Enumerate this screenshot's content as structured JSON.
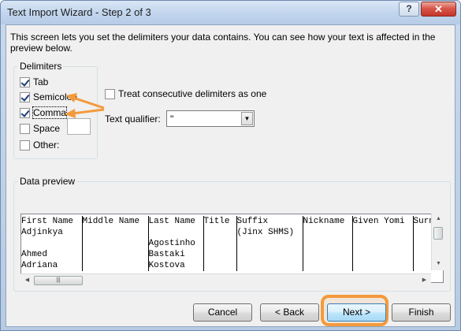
{
  "window": {
    "title": "Text Import Wizard - Step 2 of 3",
    "help_label": "?",
    "close_label": "✕"
  },
  "intro": "This screen lets you set the delimiters your data contains.  You can see how your text is affected in the preview below.",
  "delimiters": {
    "legend": "Delimiters",
    "items": [
      {
        "label": "Tab",
        "checked": true
      },
      {
        "label": "Semicolon",
        "checked": true
      },
      {
        "label": "Comma",
        "checked": true
      },
      {
        "label": "Space",
        "checked": false
      },
      {
        "label": "Other:",
        "checked": false
      }
    ],
    "other_value": ""
  },
  "options": {
    "treat_consecutive_label": "Treat consecutive delimiters as one",
    "treat_consecutive_checked": false,
    "text_qualifier_label": "Text qualifier:",
    "text_qualifier_value": "\""
  },
  "preview": {
    "legend": "Data preview",
    "columns": [
      "First Name",
      "Middle Name",
      "Last Name",
      "Title",
      "Suffix",
      "Nickname",
      "Given Yomi",
      "Surn"
    ],
    "rows": [
      [
        "Adjinkya",
        "",
        "",
        "",
        "(Jinx SHMS)",
        "",
        "",
        ""
      ],
      [
        "",
        "",
        "Agostinho",
        "",
        "",
        "",
        "",
        ""
      ],
      [
        "Ahmed",
        "",
        "Bastaki",
        "",
        "",
        "",
        "",
        ""
      ],
      [
        "Adriana",
        "",
        "Kostova",
        "",
        "",
        "",
        "",
        ""
      ]
    ]
  },
  "buttons": {
    "cancel": "Cancel",
    "back": "< Back",
    "next": "Next >",
    "finish": "Finish"
  },
  "colors": {
    "annotation_arrow": "#f39a3c",
    "close_button": "#c3352a"
  }
}
